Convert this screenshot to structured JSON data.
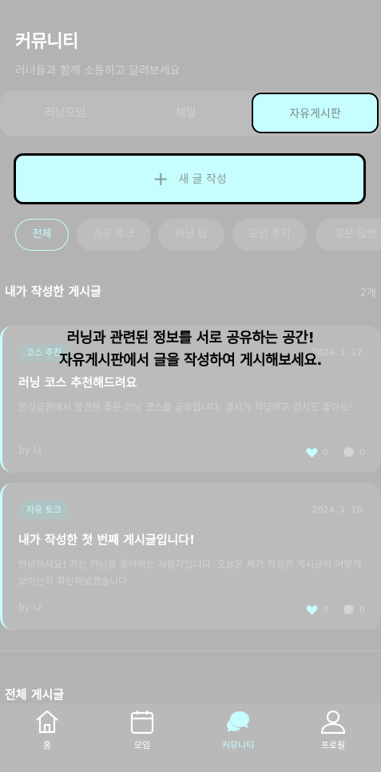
{
  "header": {
    "title": "커뮤니티",
    "subtitle": "러너들과 함께 소통하고 달려보세요"
  },
  "tabs": [
    {
      "label": "러닝모임",
      "active": false
    },
    {
      "label": "채팅",
      "active": false
    },
    {
      "label": "자유게시판",
      "active": true
    }
  ],
  "write_button": {
    "label": "새 글 작성",
    "icon": "plus-icon"
  },
  "filters": [
    {
      "label": "전체",
      "active": true
    },
    {
      "label": "자유 토크",
      "active": false
    },
    {
      "label": "러닝 팁",
      "active": false
    },
    {
      "label": "모임 후기",
      "active": false
    },
    {
      "label": "질문 답변",
      "active": false
    }
  ],
  "my_posts": {
    "title": "내가 작성한 게시글",
    "count": "2개",
    "posts": [
      {
        "tag": "코스 추천",
        "date": "2024. 1. 17.",
        "title": "러닝 코스 추천해드려요",
        "body": "한강공원에서 발견한 좋은 러닝 코스를 공유합니다. 경사가 적당하고 경치도 좋아요!",
        "author": "by 나",
        "likes": "0",
        "comments": "0"
      },
      {
        "tag": "자유 토크",
        "date": "2024. 1. 16.",
        "title": "내가 작성한 첫 번째 게시글입니다!",
        "body": "안녕하세요! 저는 러닝을 좋아하는 사용자입니다. 오늘은 제가 작성한 게시글이 어떻게 보이는지 확인해보겠습니다.",
        "author": "by 나",
        "likes": "0",
        "comments": "0"
      }
    ]
  },
  "all_posts": {
    "title": "전체 게시글"
  },
  "overlay": {
    "line1": "러닝과 관련된 정보를 서로 공유하는 공간!",
    "line2": "자유게시판에서 글을 작성하여 게시해보세요."
  },
  "nav": [
    {
      "label": "홈",
      "icon": "home-icon",
      "active": false
    },
    {
      "label": "모임",
      "icon": "calendar-icon",
      "active": false
    },
    {
      "label": "커뮤니티",
      "icon": "chat-bubbles-icon",
      "active": true
    },
    {
      "label": "프로필",
      "icon": "user-icon",
      "active": false
    }
  ],
  "colors": {
    "accent": "#c6fdfd",
    "background": "#b3b3b3",
    "like": "#c6fdfd"
  }
}
